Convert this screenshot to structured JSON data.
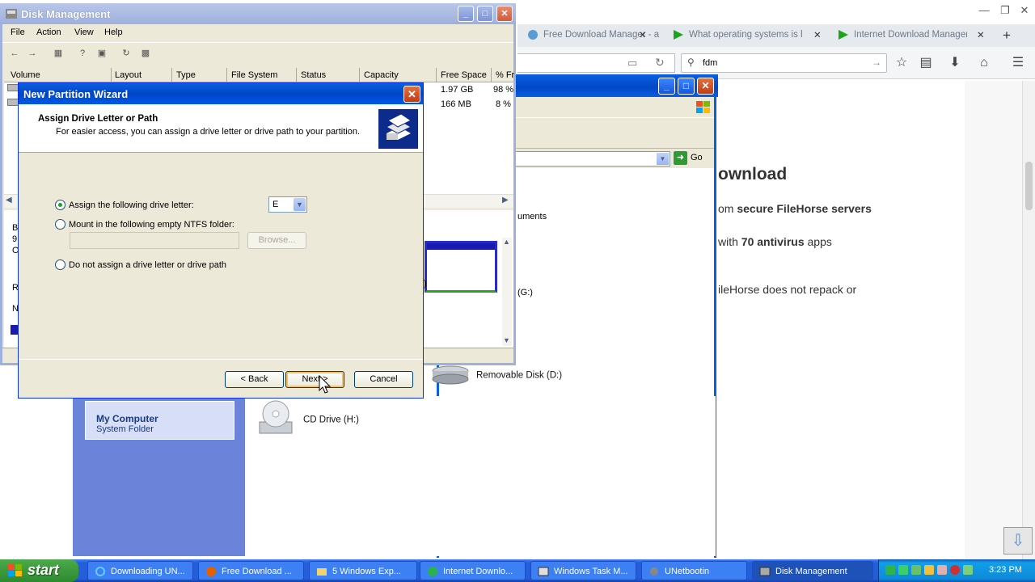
{
  "firefox": {
    "tabs": [
      {
        "label": "Free Download Manager - a"
      },
      {
        "label": "What operating systems is h"
      },
      {
        "label": "Internet Download Manager"
      }
    ],
    "new_tab": "+",
    "search_value": "fdm",
    "content": {
      "heading": "ownload",
      "line1_pre": "om ",
      "line1_bold": "secure FileHorse servers",
      "line2_pre": "with ",
      "line2_bold": "70 antivirus",
      "line2_post": " apps",
      "line3": "ileHorse does not repack or"
    }
  },
  "explorer": {
    "address_go": "Go",
    "list_text_1": "uments",
    "list_text_2": "(G:)",
    "list_text_3": ")",
    "details_title": "My Computer",
    "details_subtitle": "System Folder",
    "drives": [
      {
        "label": "Removable Disk (D:)"
      },
      {
        "label": "CD Drive (H:)"
      }
    ]
  },
  "disk_management": {
    "title": "Disk Management",
    "menu": [
      "File",
      "Action",
      "View",
      "Help"
    ],
    "columns": [
      "Volume",
      "Layout",
      "Type",
      "File System",
      "Status",
      "Capacity",
      "Free Space",
      "% Fr"
    ],
    "rows": [
      {
        "free_space": "1.97 GB",
        "pct": "98 %"
      },
      {
        "free_space": "166 MB",
        "pct": "8 %"
      }
    ],
    "left_letters": [
      "B",
      "9",
      "O",
      "R",
      "N"
    ]
  },
  "wizard": {
    "title": "New Partition Wizard",
    "heading": "Assign Drive Letter or Path",
    "subheading": "For easier access, you can assign a drive letter or drive path to your partition.",
    "option_assign": "Assign the following drive letter:",
    "drive_letter": "E",
    "option_mount": "Mount in the following empty NTFS folder:",
    "browse_label": "Browse...",
    "option_none": "Do not assign a drive letter or drive path",
    "back_label": "< Back",
    "next_label": "Next >",
    "cancel_label": "Cancel"
  },
  "taskbar": {
    "start_label": "start",
    "items": [
      {
        "label": "Downloading UN..."
      },
      {
        "label": "Free Download ..."
      },
      {
        "label": "5 Windows Exp..."
      },
      {
        "label": "Internet Downlo..."
      },
      {
        "label": "Windows Task M..."
      },
      {
        "label": "UNetbootin"
      },
      {
        "label": "Disk Management"
      }
    ],
    "clock": "3:23 PM"
  }
}
